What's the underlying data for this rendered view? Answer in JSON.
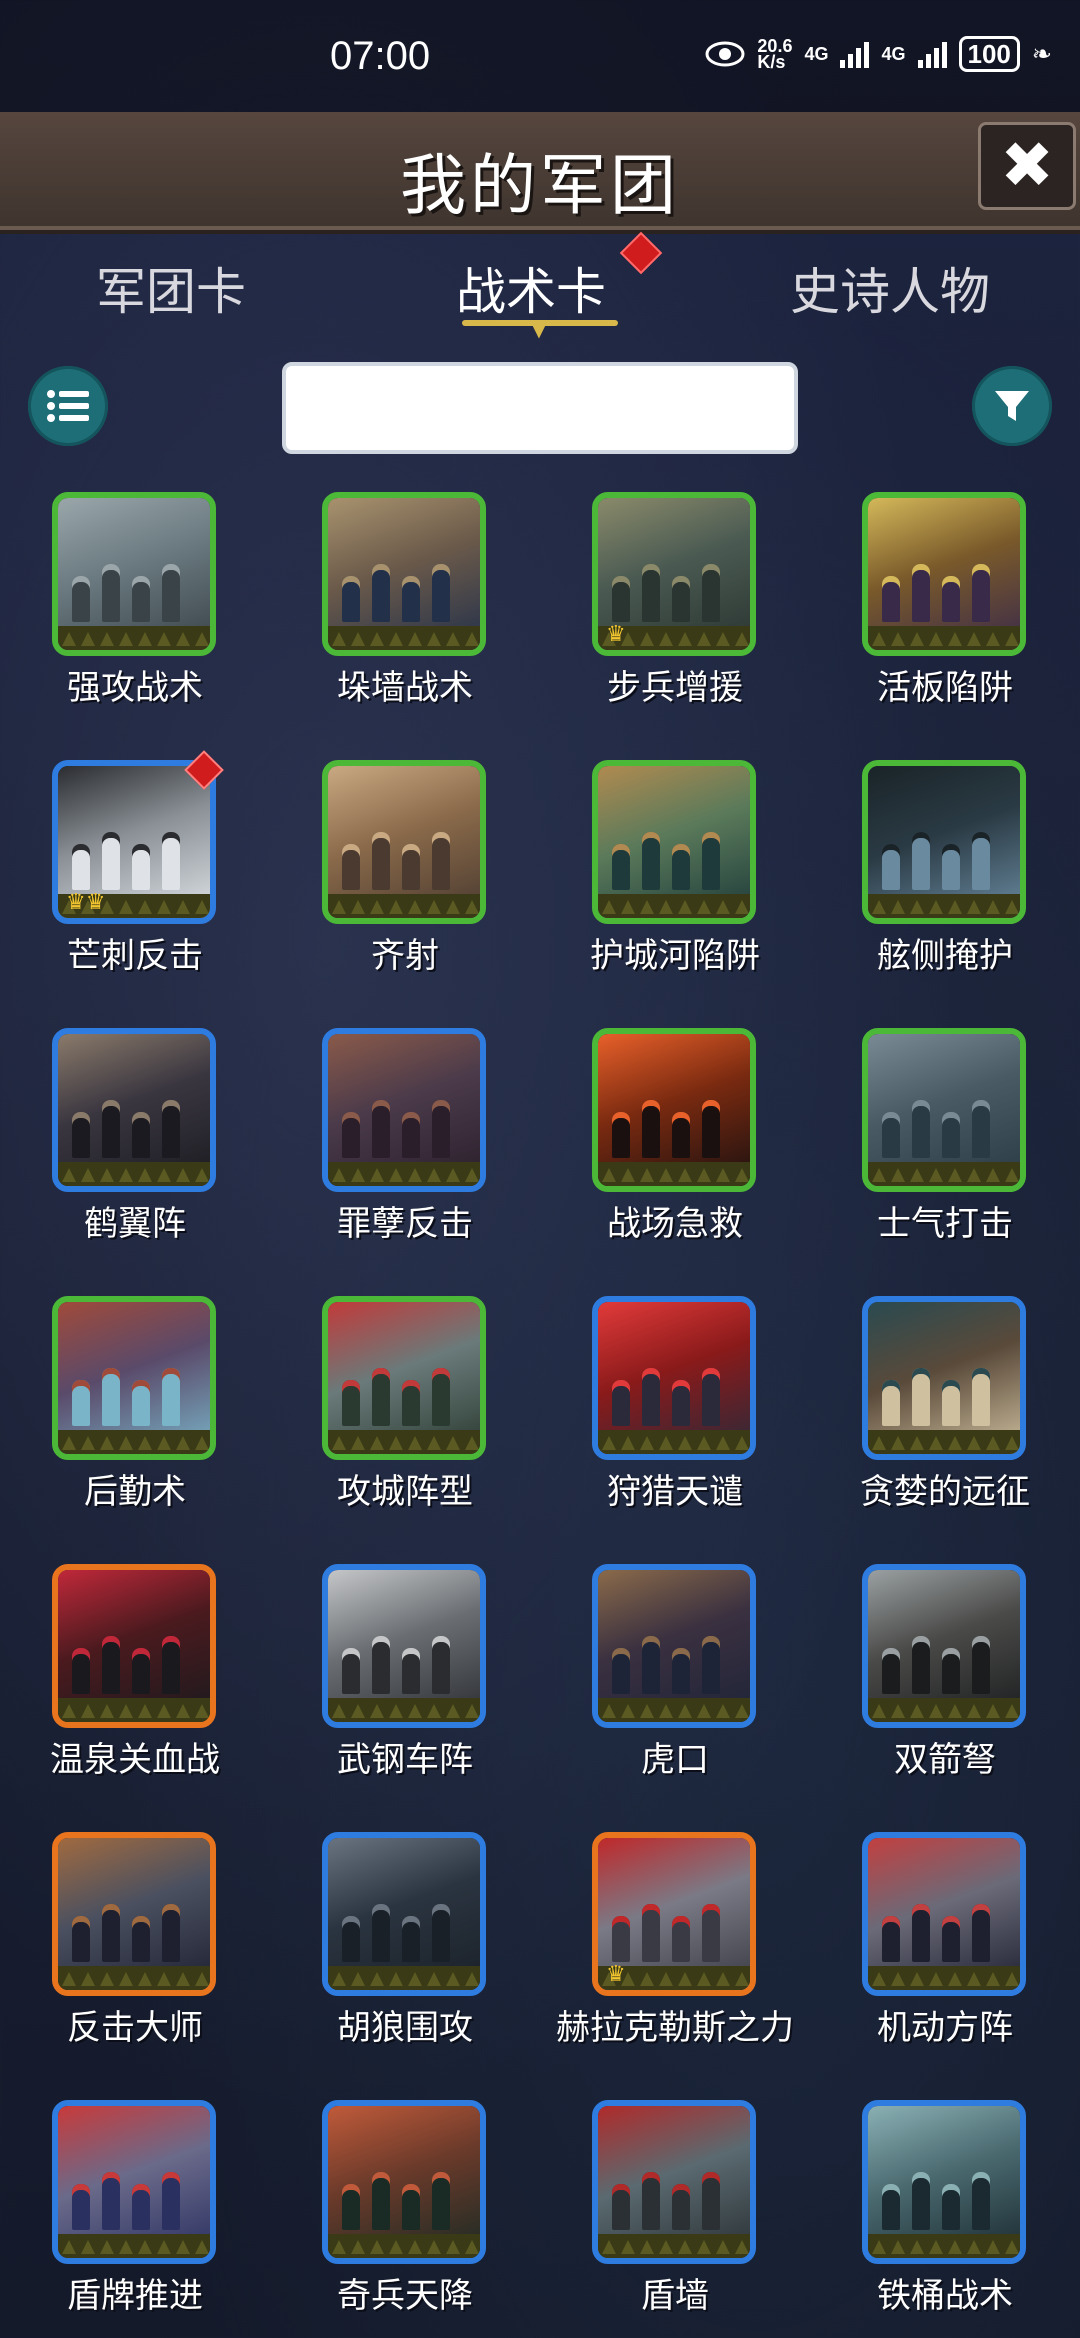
{
  "status_bar": {
    "time": "07:00",
    "network_speed": "20.6\nK/s",
    "net1": "4G",
    "net2": "4G",
    "battery": "100"
  },
  "header": {
    "title": "我的军团",
    "close_icon": "close-icon"
  },
  "tabs": [
    {
      "label": "军团卡",
      "active": false
    },
    {
      "label": "战术卡",
      "active": true
    },
    {
      "label": "史诗人物",
      "active": false
    }
  ],
  "search": {
    "value": "",
    "placeholder": ""
  },
  "cards": [
    {
      "name": "强攻战术",
      "frame": "green",
      "crown": "",
      "art": [
        "#3a4348",
        "#6a7a80",
        "#9aa6aa"
      ]
    },
    {
      "name": "垛墙战术",
      "frame": "green",
      "crown": "",
      "art": [
        "#22304a",
        "#6b5a4a",
        "#a8926e"
      ]
    },
    {
      "name": "步兵增援",
      "frame": "green",
      "crown": "♛",
      "art": [
        "#2a3430",
        "#4a5a52",
        "#8a8a6a"
      ]
    },
    {
      "name": "活板陷阱",
      "frame": "green",
      "crown": "",
      "art": [
        "#3a2a4a",
        "#7a5a2a",
        "#d4b85a"
      ]
    },
    {
      "name": "芒刺反击",
      "frame": "blue",
      "crown": "♛♛",
      "art": [
        "#dfe3e8",
        "#8a9096",
        "#2a2c30"
      ],
      "new": true
    },
    {
      "name": "齐射",
      "frame": "green",
      "crown": "",
      "art": [
        "#4a3a30",
        "#8a6a4a",
        "#c9a982"
      ]
    },
    {
      "name": "护城河陷阱",
      "frame": "green",
      "crown": "",
      "art": [
        "#1e3a3a",
        "#5a7a5a",
        "#b08a50"
      ]
    },
    {
      "name": "舷侧掩护",
      "frame": "green",
      "crown": "",
      "art": [
        "#6a8aa0",
        "#2a3a44",
        "#1a2428"
      ]
    },
    {
      "name": "鹤翼阵",
      "frame": "blue",
      "crown": "",
      "art": [
        "#1a1a20",
        "#3a3640",
        "#8a7a6a"
      ]
    },
    {
      "name": "罪孽反击",
      "frame": "blue",
      "crown": "",
      "art": [
        "#2a1e2a",
        "#4a3a4a",
        "#8a5a4a"
      ]
    },
    {
      "name": "战场急救",
      "frame": "green",
      "crown": "",
      "art": [
        "#1a1010",
        "#7a2a10",
        "#e8602a"
      ]
    },
    {
      "name": "士气打击",
      "frame": "green",
      "crown": "",
      "art": [
        "#2a3a44",
        "#4a5a64",
        "#7a8a94"
      ]
    },
    {
      "name": "后勤术",
      "frame": "green",
      "crown": "",
      "art": [
        "#7ab4c8",
        "#5a4a6a",
        "#a04a3a"
      ]
    },
    {
      "name": "攻城阵型",
      "frame": "green",
      "crown": "",
      "art": [
        "#2a3a30",
        "#6a7a7a",
        "#c23a3a"
      ]
    },
    {
      "name": "狩猎天谴",
      "frame": "blue",
      "crown": "",
      "art": [
        "#2a2a3a",
        "#8a1a1a",
        "#e23a3a"
      ]
    },
    {
      "name": "贪婪的远征",
      "frame": "blue",
      "crown": "",
      "art": [
        "#cfc0a0",
        "#5a4a3a",
        "#2a4a50"
      ]
    },
    {
      "name": "温泉关血战",
      "frame": "orange",
      "crown": "",
      "art": [
        "#1a1a1e",
        "#4a1a1e",
        "#c0283a"
      ]
    },
    {
      "name": "武钢车阵",
      "frame": "blue",
      "crown": "",
      "art": [
        "#2a2c30",
        "#6a6e72",
        "#c4c6c8"
      ]
    },
    {
      "name": "虎口",
      "frame": "blue",
      "crown": "",
      "art": [
        "#1e2438",
        "#3a3040",
        "#8a6a4a"
      ]
    },
    {
      "name": "双箭弩",
      "frame": "blue",
      "crown": "",
      "art": [
        "#1a1c1e",
        "#4a4a48",
        "#9aa0a2"
      ]
    },
    {
      "name": "反击大师",
      "frame": "orange",
      "crown": "",
      "art": [
        "#1e2030",
        "#4a5060",
        "#a06a40"
      ]
    },
    {
      "name": "胡狼围攻",
      "frame": "blue",
      "crown": "",
      "art": [
        "#1a2028",
        "#2a3440",
        "#6a7480"
      ]
    },
    {
      "name": "赫拉克勒斯之力",
      "frame": "orange",
      "crown": "♛",
      "art": [
        "#3a3a44",
        "#7a7a86",
        "#c0282a"
      ]
    },
    {
      "name": "机动方阵",
      "frame": "blue",
      "crown": "",
      "art": [
        "#1e2030",
        "#6a6a78",
        "#c24040"
      ]
    },
    {
      "name": "盾牌推进",
      "frame": "blue",
      "crown": "",
      "art": [
        "#2a3060",
        "#6a6a8a",
        "#c83a3a"
      ]
    },
    {
      "name": "奇兵天降",
      "frame": "blue",
      "crown": "",
      "art": [
        "#1a2a24",
        "#6a3a2a",
        "#c05a3a"
      ]
    },
    {
      "name": "盾墙",
      "frame": "blue",
      "crown": "",
      "art": [
        "#2a3034",
        "#5a6a70",
        "#b02a2a"
      ]
    },
    {
      "name": "铁桶战术",
      "frame": "blue",
      "crown": "",
      "art": [
        "#1a2a30",
        "#4a6a70",
        "#8ab0b4"
      ]
    }
  ],
  "icons": {
    "list": "list-icon",
    "filter": "filter-icon",
    "eye": "eye-icon"
  }
}
